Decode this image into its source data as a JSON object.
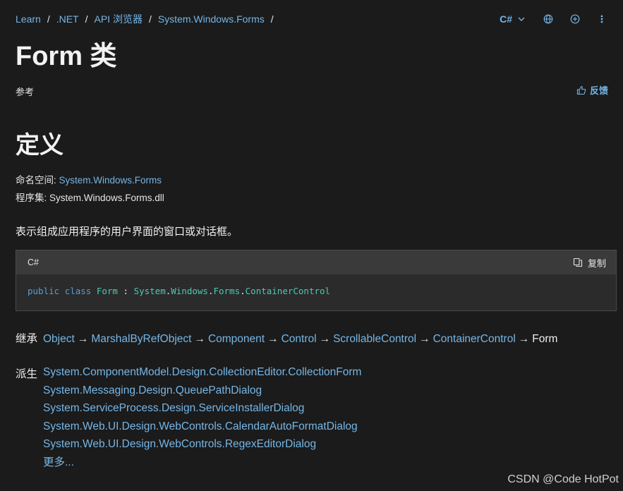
{
  "breadcrumb": [
    {
      "label": "Learn"
    },
    {
      "label": ".NET"
    },
    {
      "label": "API 浏览器"
    },
    {
      "label": "System.Windows.Forms"
    }
  ],
  "breadcrumb_sep": "/",
  "header": {
    "language": "C#",
    "icons": [
      "globe-icon",
      "plus-circle-icon",
      "more-vertical-icon"
    ]
  },
  "page": {
    "title": "Form 类",
    "reference_label": "参考",
    "feedback_label": "反馈"
  },
  "definition": {
    "title": "定义",
    "namespace_key": "命名空间:",
    "namespace_value": "System.Windows.Forms",
    "assembly_key": "程序集:",
    "assembly_value": "System.Windows.Forms.dll",
    "summary": "表示组成应用程序的用户界面的窗口或对话框。"
  },
  "code": {
    "language": "C#",
    "copy_label": "复制",
    "tokens": {
      "kw1": "public",
      "kw2": "class",
      "name": "Form",
      "colon": ":",
      "ns1": "System",
      "ns2": "Windows",
      "ns3": "Forms",
      "base": "ContainerControl",
      "dot": "."
    }
  },
  "inheritance": {
    "label": "继承",
    "chain": [
      "Object",
      "MarshalByRefObject",
      "Component",
      "Control",
      "ScrollableControl",
      "ContainerControl"
    ],
    "current": "Form",
    "arrow": "→"
  },
  "derived": {
    "label": "派生",
    "items": [
      "System.ComponentModel.Design.CollectionEditor.CollectionForm",
      "System.Messaging.Design.QueuePathDialog",
      "System.ServiceProcess.Design.ServiceInstallerDialog",
      "System.Web.UI.Design.WebControls.CalendarAutoFormatDialog",
      "System.Web.UI.Design.WebControls.RegexEditorDialog"
    ],
    "more_label": "更多..."
  },
  "watermark": "CSDN @Code HotPot",
  "colors": {
    "background": "#1b1b1b",
    "link": "#75b6e7",
    "keyword": "#569cd6",
    "type": "#4ec9b0"
  }
}
